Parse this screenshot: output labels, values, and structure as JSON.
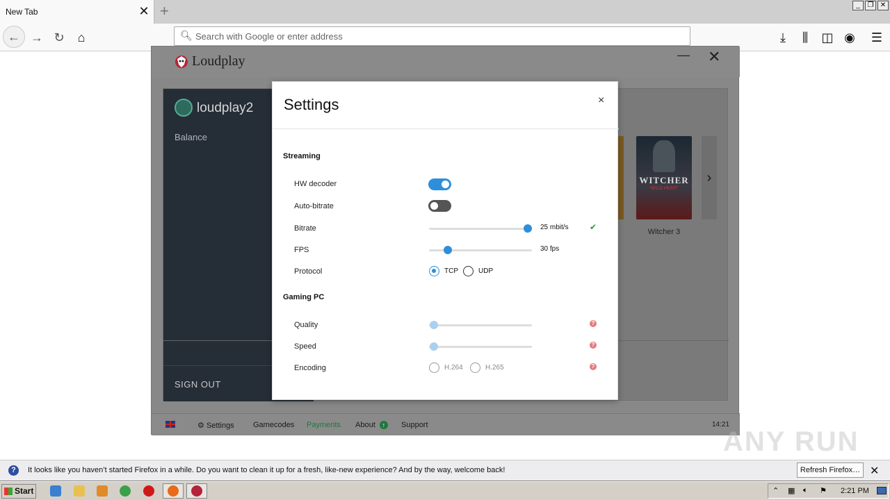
{
  "browser": {
    "tab_title": "New Tab",
    "tab_close": "✕",
    "new_tab": "+",
    "url_placeholder": "Search with Google or enter address",
    "window_controls": [
      "_",
      "❐",
      "✕"
    ]
  },
  "app": {
    "title": "Loudplay",
    "minimize": "—",
    "close": "✕",
    "sidebar": {
      "username": "loudplay2",
      "balance_label": "Balance",
      "sign_out": "SIGN OUT"
    },
    "game": {
      "logo_text": "WITCHER",
      "logo_sub": "WILD HUNT",
      "label": "Witcher 3"
    },
    "footer": {
      "settings": "Settings",
      "gamecodes": "Gamecodes",
      "payments": "Payments",
      "about": "About",
      "support": "Support",
      "time": "14:21"
    }
  },
  "settings_modal": {
    "title": "Settings",
    "close": "×",
    "streaming": {
      "section": "Streaming",
      "hw_decoder": {
        "label": "HW decoder",
        "on": true
      },
      "auto_bitrate": {
        "label": "Auto-bitrate",
        "on": false
      },
      "bitrate": {
        "label": "Bitrate",
        "value": "25 mbit/s",
        "fraction": 0.96
      },
      "fps": {
        "label": "FPS",
        "value": "30 fps",
        "fraction": 0.18
      },
      "protocol": {
        "label": "Protocol",
        "options": [
          "TCP",
          "UDP"
        ],
        "selected": "TCP"
      }
    },
    "gaming_pc": {
      "section": "Gaming PC",
      "quality": {
        "label": "Quality",
        "fraction": 0.05
      },
      "speed": {
        "label": "Speed",
        "fraction": 0.05
      },
      "encoding": {
        "label": "Encoding",
        "options": [
          "H.264",
          "H.265"
        ]
      }
    },
    "colors": {
      "accent": "#2d8fdb",
      "help": "#e57b7b",
      "check": "#2a9a3a"
    }
  },
  "notification": {
    "text": "It looks like you haven’t started Firefox in a while. Do you want to clean it up for a fresh, like-new experience? And by the way, welcome back!",
    "button": "Refresh Firefox…",
    "close": "✕"
  },
  "watermark": "ANY RUN",
  "taskbar": {
    "start": "Start",
    "time": "2:21 PM"
  }
}
